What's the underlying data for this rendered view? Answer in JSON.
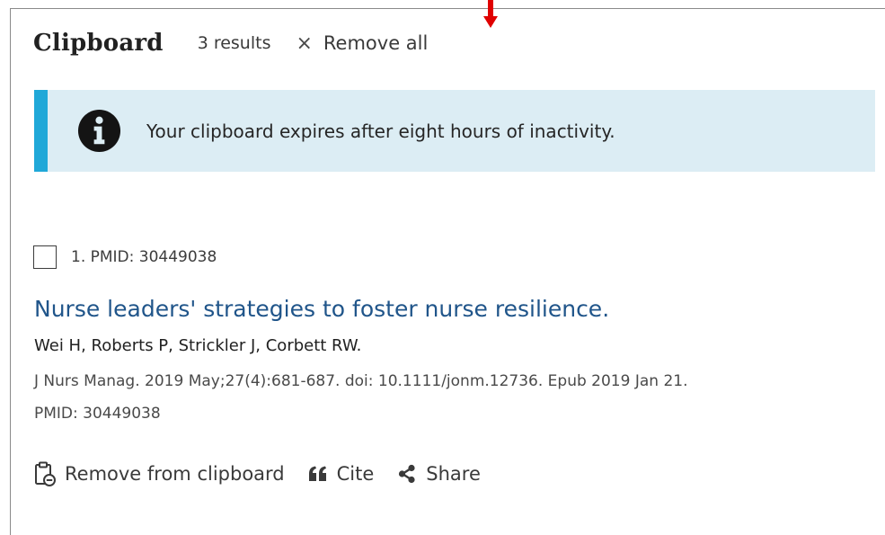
{
  "header": {
    "title": "Clipboard",
    "count": "3 results",
    "remove_all_label": "Remove all",
    "remove_all_icon": "close-icon"
  },
  "alert": {
    "icon": "info-icon",
    "message": "Your clipboard expires after eight hours of inactivity."
  },
  "colors": {
    "alert_border": "#20a8d8",
    "alert_background": "#dcedf4",
    "link": "#20558a",
    "arrow": "#e00000"
  },
  "result": {
    "number_label": "1. PMID: 30449038",
    "title": "Nurse leaders' strategies to foster nurse resilience.",
    "authors": "Wei H, Roberts P, Strickler J, Corbett RW.",
    "citation": "J Nurs Manag. 2019 May;27(4):681-687. doi: 10.1111/jonm.12736. Epub 2019 Jan 21.",
    "pmid": "PMID: 30449038",
    "actions": [
      {
        "label": "Remove from clipboard",
        "icon": "clipboard-remove-icon"
      },
      {
        "label": "Cite",
        "icon": "quote-icon"
      },
      {
        "label": "Share",
        "icon": "share-icon"
      }
    ]
  }
}
